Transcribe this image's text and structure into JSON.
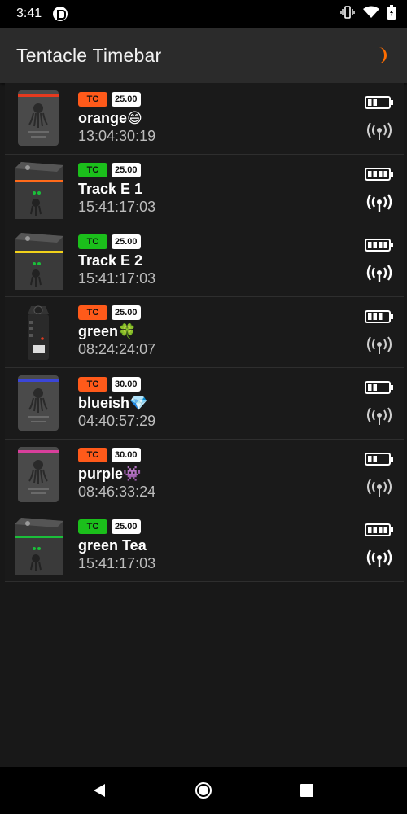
{
  "status_bar": {
    "time": "3:41"
  },
  "app_bar": {
    "title": "Tentacle Timebar",
    "accent": "#ff6d00"
  },
  "devices": [
    {
      "tc": "TC",
      "fps": "25.00",
      "name": "orange😄",
      "timecode": "13:04:30:19",
      "type": "sync",
      "stripe": "#e53a1f",
      "tc_color": "#ff5a1a",
      "battery": 0.5,
      "signal": "weak"
    },
    {
      "tc": "TC",
      "fps": "25.00",
      "name": "Track E 1",
      "timecode": "15:41:17:03",
      "type": "track",
      "stripe": "#ff6a1a",
      "tc_color": "#1bbf1b",
      "battery": 1.0,
      "signal": "strong"
    },
    {
      "tc": "TC",
      "fps": "25.00",
      "name": "Track E 2",
      "timecode": "15:41:17:03",
      "type": "track",
      "stripe": "#f2d21a",
      "tc_color": "#1bbf1b",
      "battery": 1.0,
      "signal": "strong"
    },
    {
      "tc": "TC",
      "fps": "25.00",
      "name": "green🍀",
      "timecode": "08:24:24:07",
      "type": "recorder",
      "stripe": "#ff5a1a",
      "tc_color": "#ff5a1a",
      "battery": 0.75,
      "signal": "weak"
    },
    {
      "tc": "TC",
      "fps": "30.00",
      "name": "blueish💎",
      "timecode": "04:40:57:29",
      "type": "sync",
      "stripe": "#3b46d9",
      "tc_color": "#ff5a1a",
      "battery": 0.5,
      "signal": "weak"
    },
    {
      "tc": "TC",
      "fps": "30.00",
      "name": "purple👾",
      "timecode": "08:46:33:24",
      "type": "sync",
      "stripe": "#d93f9c",
      "tc_color": "#ff5a1a",
      "battery": 0.5,
      "signal": "weak"
    },
    {
      "tc": "TC",
      "fps": "25.00",
      "name": "green Tea",
      "timecode": "15:41:17:03",
      "type": "track",
      "stripe": "#1bbf3a",
      "tc_color": "#1bbf1b",
      "battery": 1.0,
      "signal": "strong"
    }
  ]
}
